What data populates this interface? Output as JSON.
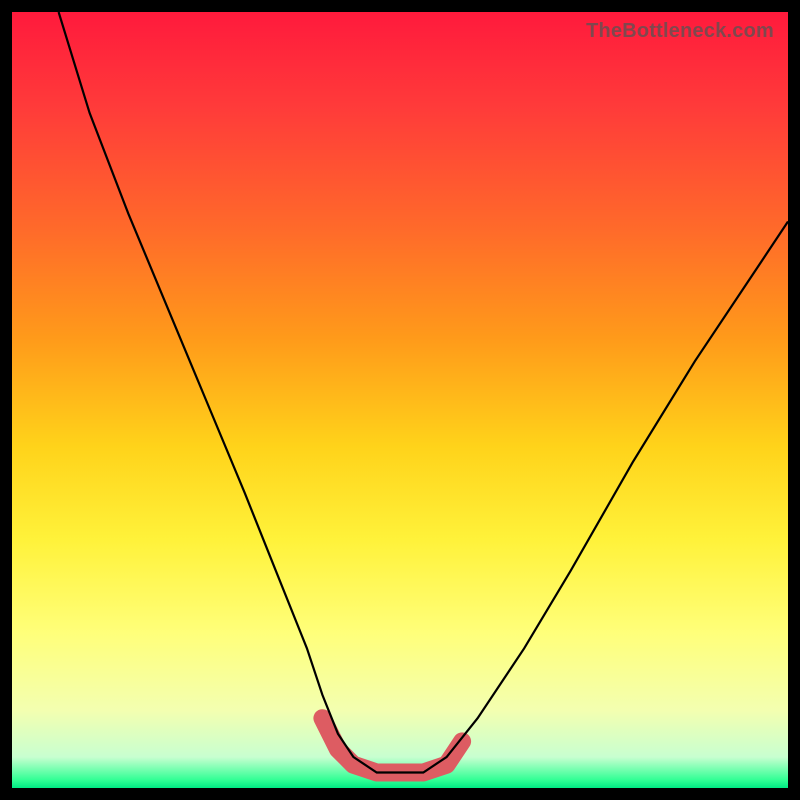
{
  "watermark": "TheBottleneck.com",
  "chart_data": {
    "type": "line",
    "title": "",
    "xlabel": "",
    "ylabel": "",
    "xlim": [
      0,
      100
    ],
    "ylim": [
      0,
      100
    ],
    "series": [
      {
        "name": "curve",
        "x": [
          6,
          10,
          15,
          20,
          25,
          30,
          34,
          38,
          40,
          42,
          44,
          47,
          50,
          53,
          56,
          60,
          66,
          72,
          80,
          88,
          96,
          100
        ],
        "y": [
          100,
          87,
          74,
          62,
          50,
          38,
          28,
          18,
          12,
          7,
          4,
          2,
          2,
          2,
          4,
          9,
          18,
          28,
          42,
          55,
          67,
          73
        ]
      },
      {
        "name": "highlight",
        "x": [
          40,
          42,
          44,
          47,
          50,
          53,
          56,
          58
        ],
        "y": [
          9,
          5,
          3,
          2,
          2,
          2,
          3,
          6
        ]
      }
    ],
    "colors": {
      "curve": "#000000",
      "highlight": "#dd5c62",
      "gradient_top": "#ff1a3c",
      "gradient_bottom": "#00ea84"
    }
  }
}
